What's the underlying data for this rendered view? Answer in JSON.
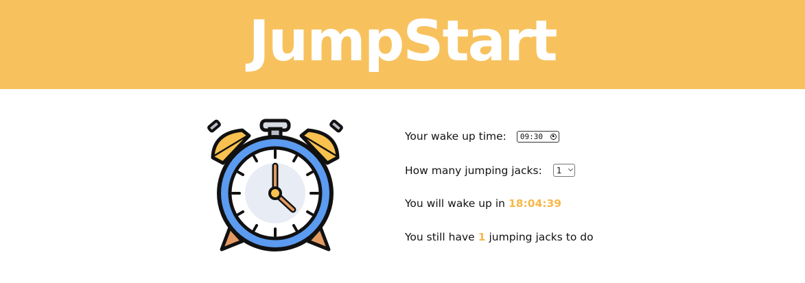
{
  "header": {
    "title": "JumpStart",
    "background": "#F7C25E"
  },
  "illustration": {
    "icon": "alarm-clock-icon"
  },
  "form": {
    "wake_label": "Your wake up time:",
    "wake_time_value": "09:30",
    "jacks_label": "How many jumping jacks:",
    "jacks_selected": "1"
  },
  "status": {
    "wake_prefix": "You will wake up in",
    "countdown": "18:04:39",
    "remaining_prefix": "You still have",
    "remaining_count": "1",
    "remaining_suffix": "jumping jacks to do"
  },
  "colors": {
    "accent": "#F7B84A",
    "clock_blue": "#5B9BF0",
    "clock_yellow": "#F9C14F"
  }
}
